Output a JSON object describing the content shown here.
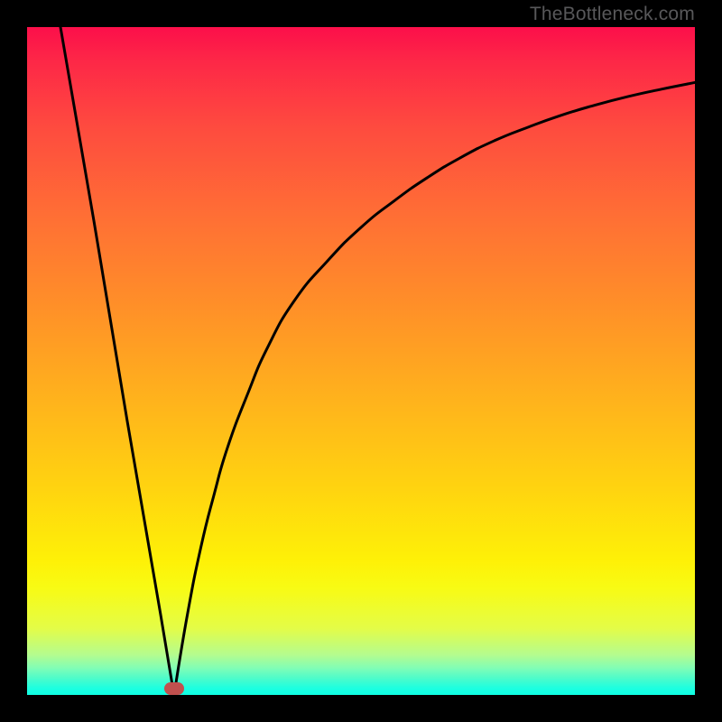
{
  "watermark": "TheBottleneck.com",
  "colors": {
    "frame": "#000000",
    "gradient_top": "#fc0f4a",
    "gradient_mid1": "#ff9028",
    "gradient_mid2": "#ffd60f",
    "gradient_bottom": "#10ffe4",
    "curve": "#000000",
    "marker": "#c1504e"
  },
  "chart_data": {
    "type": "line",
    "title": "",
    "xlabel": "",
    "ylabel": "",
    "xlim": [
      0,
      100
    ],
    "ylim": [
      0,
      100
    ],
    "annotations": [
      "TheBottleneck.com"
    ],
    "marker": {
      "x": 22,
      "y": 0
    },
    "series": [
      {
        "name": "left-branch",
        "x": [
          5,
          10,
          15,
          20,
          22
        ],
        "values": [
          100,
          71,
          41,
          12,
          0
        ]
      },
      {
        "name": "right-branch",
        "x": [
          22,
          24,
          26,
          28,
          30,
          33,
          36,
          40,
          45,
          50,
          55,
          60,
          65,
          70,
          75,
          80,
          85,
          90,
          95,
          100
        ],
        "values": [
          0,
          12,
          22,
          30,
          37,
          45,
          52,
          59,
          65,
          70,
          74,
          77.5,
          80.5,
          83,
          85,
          86.8,
          88.3,
          89.6,
          90.7,
          91.7
        ]
      }
    ]
  }
}
